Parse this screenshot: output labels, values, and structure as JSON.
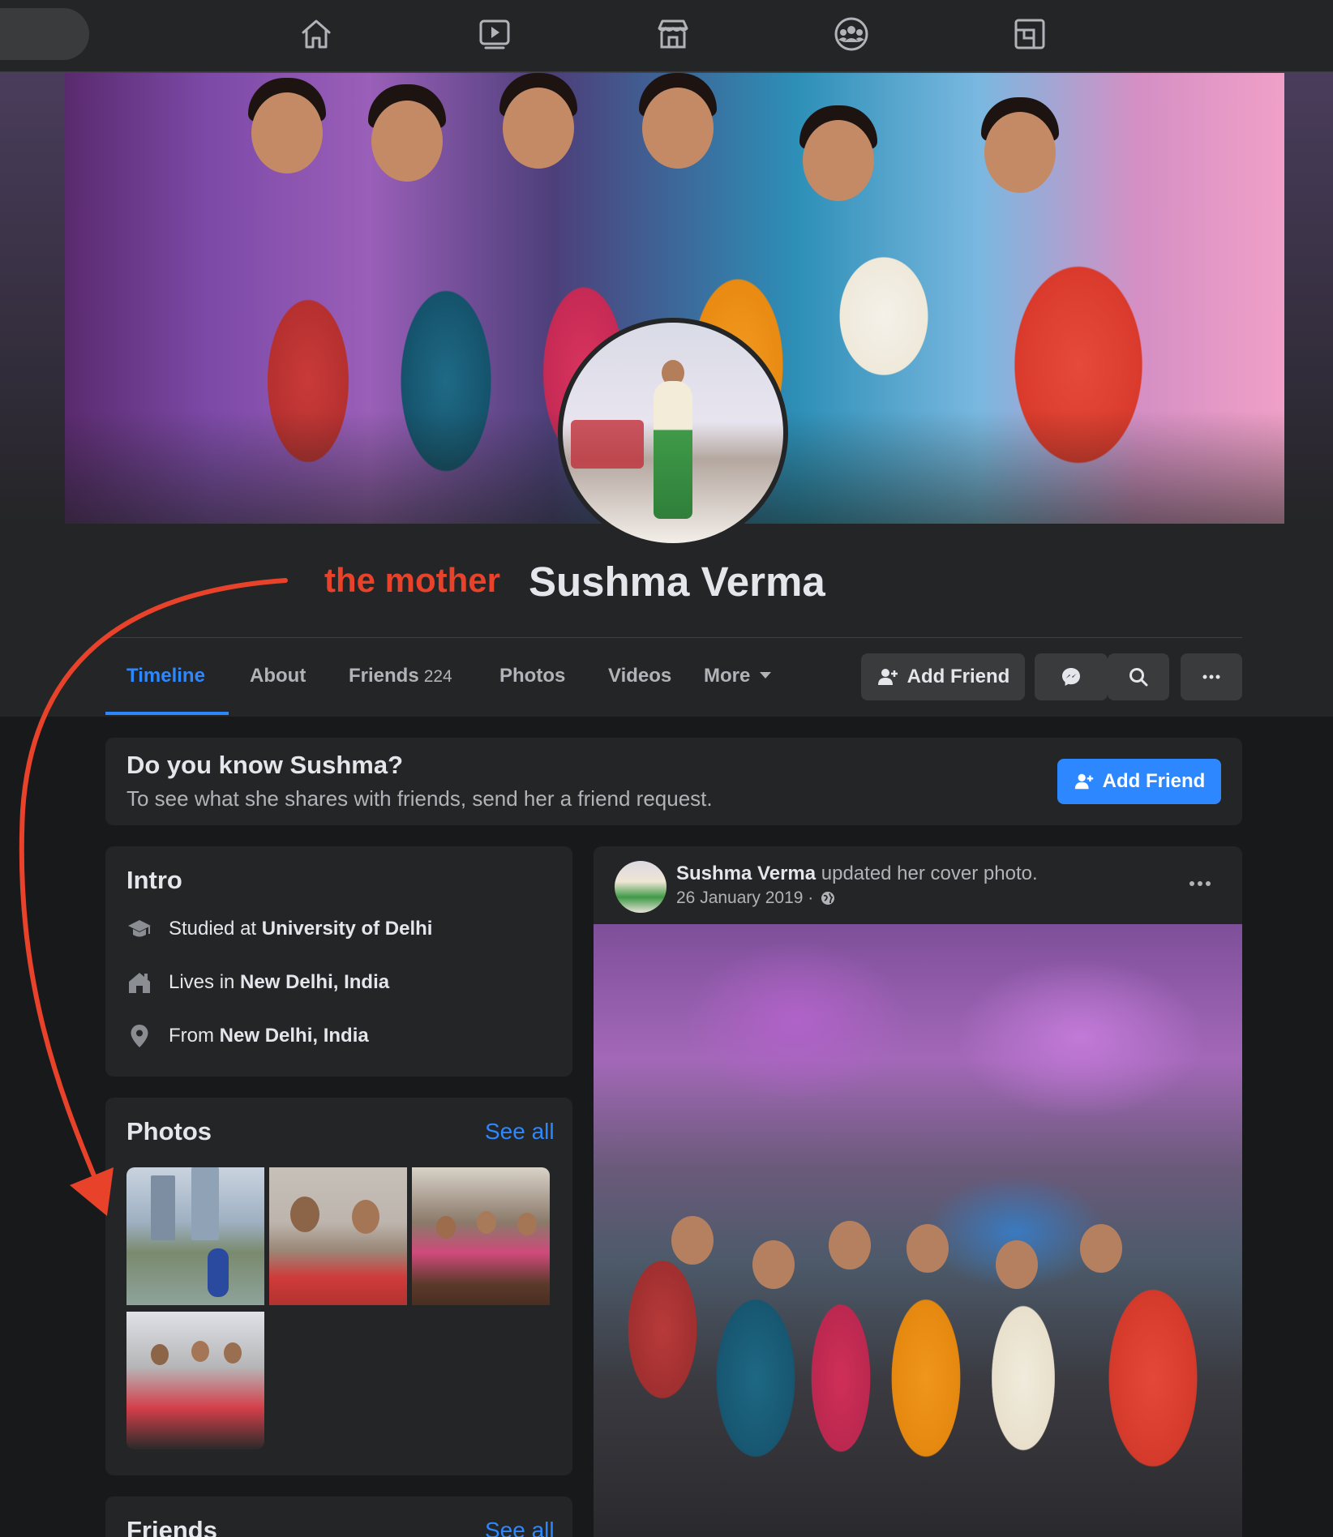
{
  "topnav": {
    "icons": [
      "home-icon",
      "watch-icon",
      "marketplace-icon",
      "groups-icon",
      "gaming-icon"
    ]
  },
  "profile": {
    "annotation": "the mother",
    "name": "Sushma Verma"
  },
  "tabs": {
    "timeline": "Timeline",
    "about": "About",
    "friends": "Friends",
    "friends_count": "224",
    "photos": "Photos",
    "videos": "Videos",
    "more": "More"
  },
  "actions": {
    "add_friend": "Add Friend"
  },
  "know_card": {
    "title": "Do you know Sushma?",
    "subtitle": "To see what she shares with friends, send her a friend request.",
    "button": "Add Friend"
  },
  "intro": {
    "title": "Intro",
    "items": [
      {
        "prefix": "Studied at ",
        "value": "University of Delhi",
        "icon": "graduation-cap-icon"
      },
      {
        "prefix": "Lives in ",
        "value": "New Delhi, India",
        "icon": "house-icon"
      },
      {
        "prefix": "From ",
        "value": "New Delhi, India",
        "icon": "location-pin-icon"
      }
    ]
  },
  "photos": {
    "title": "Photos",
    "see_all": "See all"
  },
  "friends": {
    "title": "Friends",
    "see_all": "See all"
  },
  "post": {
    "author": "Sushma Verma",
    "action": " updated her cover photo.",
    "date": "26 January 2019 · "
  },
  "colors": {
    "accent": "#2d88ff",
    "annotation": "#e8422b",
    "background": "#18191a",
    "card": "#242526"
  }
}
